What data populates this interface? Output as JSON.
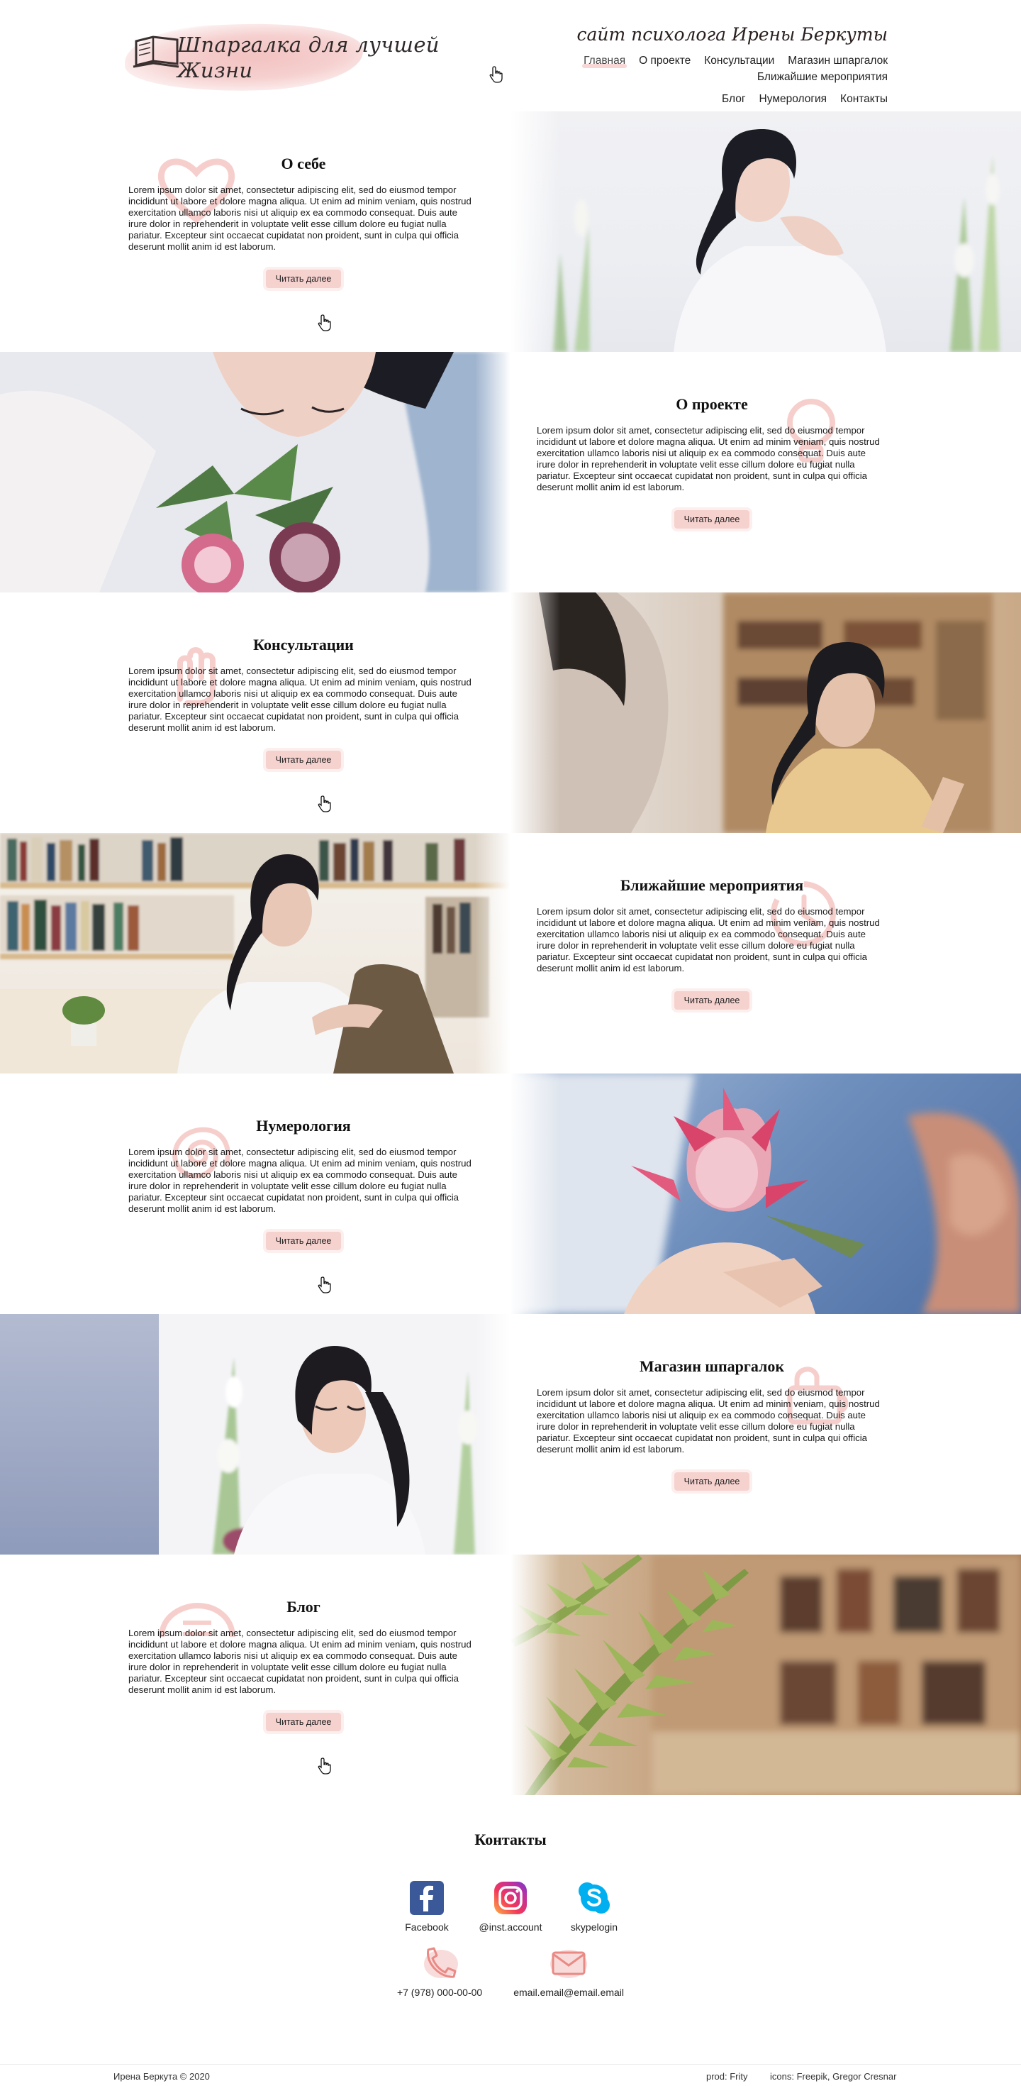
{
  "header": {
    "logo_line1": "Шпаргалка для лучшей",
    "logo_line2": "Жизни",
    "tagline": "сайт психолога Ирены Беркуты",
    "nav": [
      {
        "label": "Главная",
        "active": true
      },
      {
        "label": "О проекте",
        "active": false
      },
      {
        "label": "Консультации",
        "active": false
      },
      {
        "label": "Магазин шпаргалок",
        "active": false
      },
      {
        "label": "Ближайшие мероприятия",
        "active": false
      },
      {
        "label": "Блог",
        "active": false
      },
      {
        "label": "Нумерология",
        "active": false
      },
      {
        "label": "Контакты",
        "active": false
      }
    ]
  },
  "lorem": "Lorem ipsum dolor sit amet, consectetur adipiscing elit, sed do eiusmod tempor incididunt ut labore et dolore magna aliqua. Ut enim ad minim veniam, quis nostrud exercitation ullamco laboris nisi ut aliquip ex ea commodo consequat. Duis aute irure dolor in reprehenderit in voluptate velit esse cillum dolore eu fugiat nulla pariatur. Excepteur sint occaecat cupidatat non proident, sunt in culpa qui officia deserunt mollit anim id est laborum.",
  "read_more": "Читать далее",
  "sections": [
    {
      "title": "О себе",
      "text_side": "left",
      "deco_icon": "heart-icon",
      "photo": "woman-portrait-flowers"
    },
    {
      "title": "О проекте",
      "text_side": "right",
      "deco_icon": "bulb-icon",
      "photo": "woman-smelling-protea"
    },
    {
      "title": "Консультации",
      "text_side": "left",
      "deco_icon": "hand-icon",
      "photo": "consultation-conversation"
    },
    {
      "title": "Ближайшие мероприятия",
      "text_side": "right",
      "deco_icon": "clock-icon",
      "photo": "woman-in-library"
    },
    {
      "title": "Нумерология",
      "text_side": "left",
      "deco_icon": "spiral-icon",
      "photo": "hands-holding-protea"
    },
    {
      "title": "Магазин шпаргалок",
      "text_side": "right",
      "deco_icon": "shop-icon",
      "photo": "woman-smiling-flowers"
    },
    {
      "title": "Блог",
      "text_side": "left",
      "deco_icon": "blog-icon",
      "photo": "fern-bookshelf"
    }
  ],
  "contacts": {
    "title": "Контакты",
    "socials": [
      {
        "label": "Facebook",
        "icon": "facebook-icon"
      },
      {
        "label": "@inst.account",
        "icon": "instagram-icon"
      },
      {
        "label": "skypelogin",
        "icon": "skype-icon"
      }
    ],
    "phone": "+7 (978) 000-00-00",
    "email": "email.email@email.email"
  },
  "footer": {
    "copyright": "Ирена Беркута © 2020",
    "prod": "prod: Frity",
    "icons_credit": "icons: Freepik, Gregor Cresnar"
  },
  "colors": {
    "accent_pink": "#f6d2cf",
    "deco_pink": "#f0a9a4",
    "text": "#1a1a1a"
  }
}
